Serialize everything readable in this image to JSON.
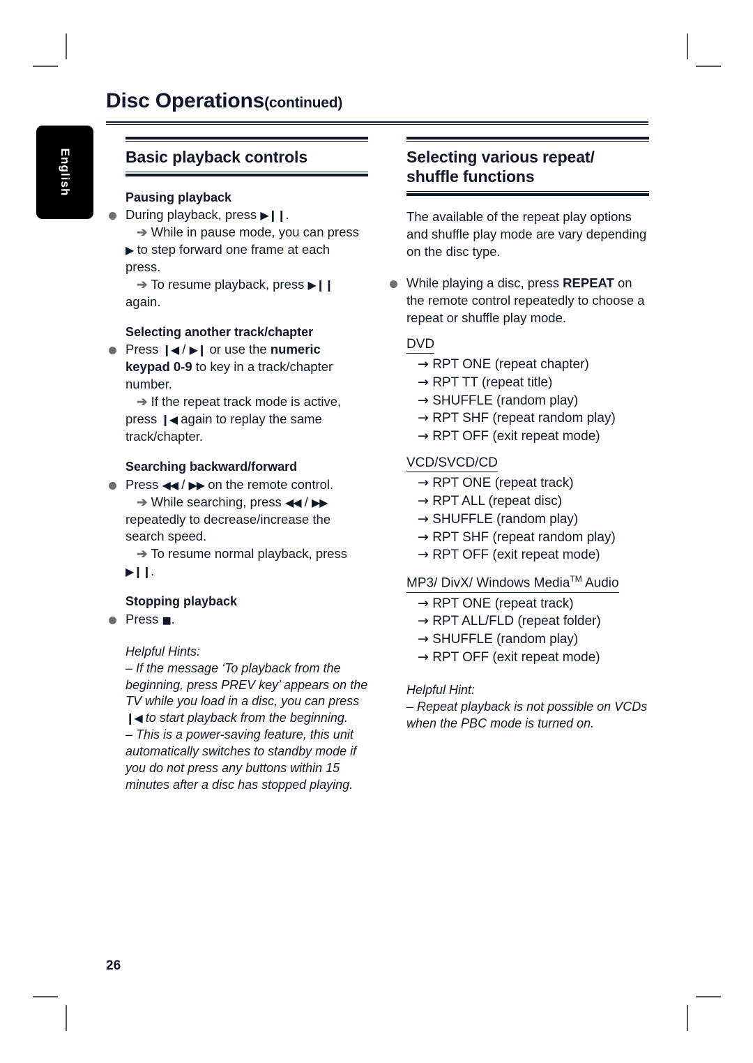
{
  "page": {
    "title_main": "Disc Operations",
    "title_suffix": "(continued)",
    "number": "26",
    "language_tab": "English"
  },
  "left_column": {
    "section_title": "Basic playback controls",
    "blocks": [
      {
        "heading": "Pausing playback",
        "bullet": "During playback, press",
        "bullet_glyph": "▶❙❙",
        "bullet_tail": ".",
        "arrows": [
          "While in pause mode, you can press",
          "To resume playback, press"
        ],
        "arrow1_glyph": "▶",
        "arrow1_tail": "to step forward one frame at each press.",
        "arrow2_glyph": "▶❙❙",
        "arrow2_tail": "again."
      },
      {
        "heading": "Selecting another track/chapter",
        "bullet_pre": "Press",
        "glyph_prev": "❙◀",
        "sep": "/",
        "glyph_next": "▶❙",
        "bullet_mid": "or use the",
        "bold_numeric": "numeric keypad 0-9",
        "bullet_post": "to key in a track/chapter number.",
        "arrow_text": "If the repeat track mode is active, press",
        "arrow_glyph": "❙◀",
        "arrow_tail": "again to replay the same track/chapter."
      },
      {
        "heading": "Searching backward/forward",
        "bullet_pre": "Press",
        "glyph_rev": "◀◀",
        "sep": "/",
        "glyph_fwd": "▶▶",
        "bullet_post": "on the remote control.",
        "arrow1_pre": "While searching, press",
        "arrow1_post": "repeatedly to decrease/increase the search speed.",
        "arrow2_pre": "To resume normal playback, press",
        "arrow2_glyph": "▶❙❙",
        "arrow2_tail": "."
      },
      {
        "heading": "Stopping playback",
        "bullet_pre": "Press",
        "glyph_stop": "■",
        "bullet_post": "."
      }
    ],
    "hints_title": "Helpful Hints:",
    "hints": [
      "– If the message ‘To playback from the beginning, press PREV key’ appears on the TV while you load in a disc, you can press",
      "– This is a power-saving feature, this unit automatically switches to standby mode if you do not press any buttons within 15 minutes after a disc has stopped playing."
    ],
    "hint1_glyph": "❙◀",
    "hint1_tail": "to start playback from the beginning."
  },
  "right_column": {
    "section_title": "Selecting various repeat/ shuffle functions",
    "intro": "The available of the repeat play options and shuffle play mode are vary depending on the disc type.",
    "bullet_pre": "While playing a disc, press",
    "bullet_bold": "REPEAT",
    "bullet_post": "on the remote control repeatedly to choose a repeat or shuffle play mode.",
    "disc_groups": [
      {
        "label": "DVD",
        "options": [
          "RPT ONE (repeat chapter)",
          "RPT TT (repeat title)",
          "SHUFFLE (random play)",
          "RPT SHF (repeat random play)",
          "RPT OFF (exit repeat mode)"
        ]
      },
      {
        "label": "VCD/SVCD/CD",
        "options": [
          "RPT ONE (repeat track)",
          "RPT ALL (repeat disc)",
          "SHUFFLE (random play)",
          "RPT SHF (repeat random play)",
          "RPT OFF (exit repeat mode)"
        ]
      },
      {
        "label": "MP3/ DivX/ Windows Media",
        "label_tm": "TM",
        "label_tail": " Audio",
        "options": [
          "RPT ONE (repeat track)",
          "RPT ALL/FLD (repeat folder)",
          "SHUFFLE (random play)",
          "RPT OFF (exit repeat mode)"
        ]
      }
    ],
    "hint_title": "Helpful Hint:",
    "hint": "– Repeat playback is not possible on VCDs when the PBC mode is turned on."
  },
  "arrow_glyph": "➔",
  "thin_arrow_glyph": "→"
}
